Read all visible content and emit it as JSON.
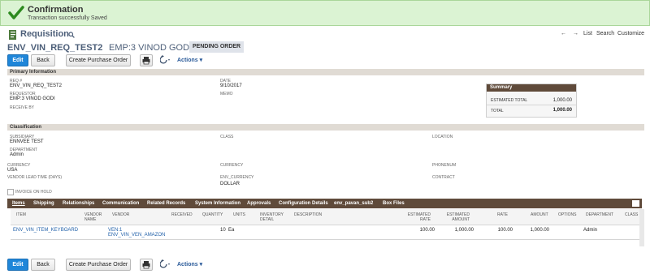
{
  "confirmation": {
    "title": "Confirmation",
    "message": "Transaction successfully Saved"
  },
  "header": {
    "page_title": "Requisition",
    "record_name": "ENV_VIN_REQ_TEST2",
    "record_sub": "EMP:3 VINOD GODI",
    "status": "PENDING ORDER",
    "nav": {
      "back_arrow": "←",
      "forward_arrow": "→",
      "list": "List",
      "search": "Search",
      "customize": "Customize"
    }
  },
  "toolbar": {
    "edit": "Edit",
    "back": "Back",
    "create_po": "Create Purchase Order",
    "actions": "Actions"
  },
  "primary": {
    "section_title": "Primary Information",
    "req_label": "REQ #",
    "req_value": "ENV_VIN_REQ_TEST2",
    "requestor_label": "REQUESTOR",
    "requestor_value": "EMP:3 VINOD GODI",
    "receive_by_label": "RECEIVE BY",
    "date_label": "DATE",
    "date_value": "9/10/2017",
    "memo_label": "MEMO"
  },
  "summary": {
    "title": "Summary",
    "estimated_total_label": "ESTIMATED TOTAL",
    "estimated_total_value": "1,000.00",
    "total_label": "TOTAL",
    "total_value": "1,000.00"
  },
  "classification": {
    "section_title": "Classification",
    "subsidiary_label": "SUBSIDIARY",
    "subsidiary_value": "ENNVEE TEST",
    "department_label": "DEPARTMENT",
    "department_value": "Admin",
    "class_label": "CLASS",
    "location_label": "LOCATION",
    "currency_label": "CURRENCY",
    "currency_value": "USA",
    "currency2_label": "CURRENCY",
    "currency2_value": "DOLLAR",
    "phonenum_label": "PHONENUM",
    "vendor_lead_label": "VENDOR LEAD TIME (DAYS)",
    "env_currency_label": "ENV_CURRENCY",
    "contract_label": "CONTRACT",
    "invoice_hold_label": "INVOICE ON HOLD"
  },
  "tabs": [
    "Items",
    "Shipping",
    "Relationships",
    "Communication",
    "Related Records",
    "System Information",
    "Approvals",
    "Configuration Details",
    "env_pavan_sub2",
    "Box Files"
  ],
  "table": {
    "headers": {
      "item": "ITEM",
      "vendor_name_1": "VENDOR",
      "vendor_name_2": "NAME",
      "vendor": "VENDOR",
      "received": "RECEIVED",
      "quantity": "QUANTITY",
      "units": "UNITS",
      "inv_1": "INVENTORY",
      "inv_2": "DETAIL",
      "description": "DESCRIPTION",
      "est_rate_1": "ESTIMATED",
      "est_rate_2": "RATE",
      "est_amount_1": "ESTIMATED",
      "est_amount_2": "AMOUNT",
      "rate": "RATE",
      "amount": "AMOUNT",
      "options": "OPTIONS",
      "department": "DEPARTMENT",
      "class": "CLASS"
    },
    "row": {
      "item": "ENV_VIN_ITEM_KEYBOARD",
      "vendor_1": "VEN:1",
      "vendor_2": "ENV_VIN_VEN_AMAZON",
      "quantity": "10",
      "units": "Ea",
      "est_rate": "100.00",
      "est_amount": "1,000.00",
      "rate": "100.00",
      "amount": "1,000.00",
      "department": "Admin"
    }
  },
  "colors": {
    "accent_blue": "#1f86d9",
    "title_blue": "#4d5f79",
    "tab_brown": "#5f4a3a",
    "confirm_green": "#dbf3d3"
  }
}
